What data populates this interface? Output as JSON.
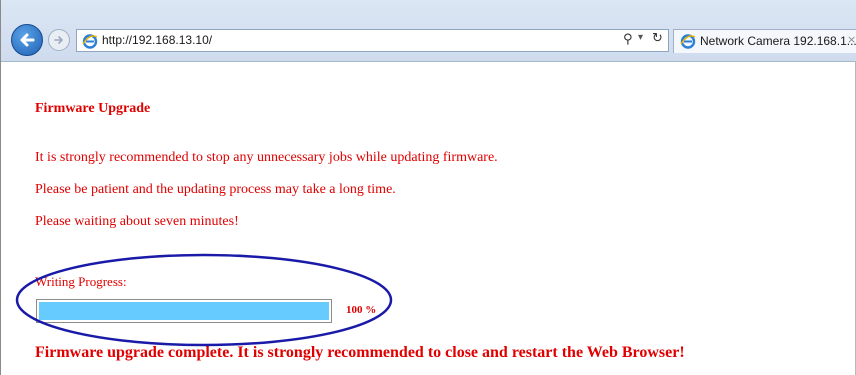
{
  "browser": {
    "url": "http://192.168.13.10/",
    "tab_title": "Network Camera 192.168.1...",
    "tab_close": "×",
    "icons": [
      "back-icon",
      "forward-icon",
      "ie-icon",
      "search-icon",
      "dropdown-icon",
      "refresh-icon",
      "close-icon"
    ]
  },
  "page": {
    "heading": "Firmware Upgrade",
    "lines": [
      "It is strongly recommended to stop any unnecessary jobs while updating firmware.",
      "Please be patient and the updating process may take a long time.",
      "Please waiting about seven minutes!"
    ],
    "progress_label": "Writing Progress:",
    "progress_text": "100 %",
    "progress_fraction": 1.0,
    "complete_message": "Firmware upgrade complete. It is strongly recommended to close and restart the Web Browser!"
  },
  "colors": {
    "text": "#e00000",
    "progress_fill": "#66ccff",
    "annotation_ellipse": "#1a1aa8"
  }
}
